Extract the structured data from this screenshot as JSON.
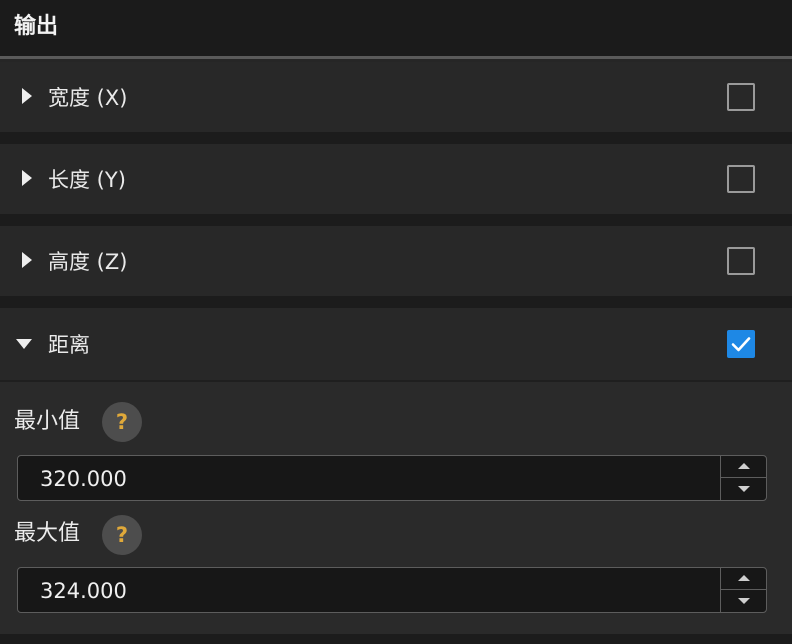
{
  "header": {
    "title": "输出"
  },
  "sections": [
    {
      "label": "宽度 (X)",
      "expanded": false,
      "checked": false
    },
    {
      "label": "长度 (Y)",
      "expanded": false,
      "checked": false
    },
    {
      "label": "高度 (Z)",
      "expanded": false,
      "checked": false
    },
    {
      "label": "距离",
      "expanded": true,
      "checked": true
    }
  ],
  "fields": {
    "min": {
      "label": "最小值",
      "help": "?",
      "value": "320.000"
    },
    "max": {
      "label": "最大值",
      "help": "?",
      "value": "324.000"
    }
  },
  "colors": {
    "accent": "#1e88e5",
    "help_mark": "#e0a93a",
    "background": "#262626"
  },
  "icons": {
    "collapsed": "chevron-right-icon",
    "expanded": "chevron-down-icon",
    "checked": "checkmark-icon",
    "help": "question-icon",
    "spin_up": "arrow-up-icon",
    "spin_down": "arrow-down-icon"
  }
}
